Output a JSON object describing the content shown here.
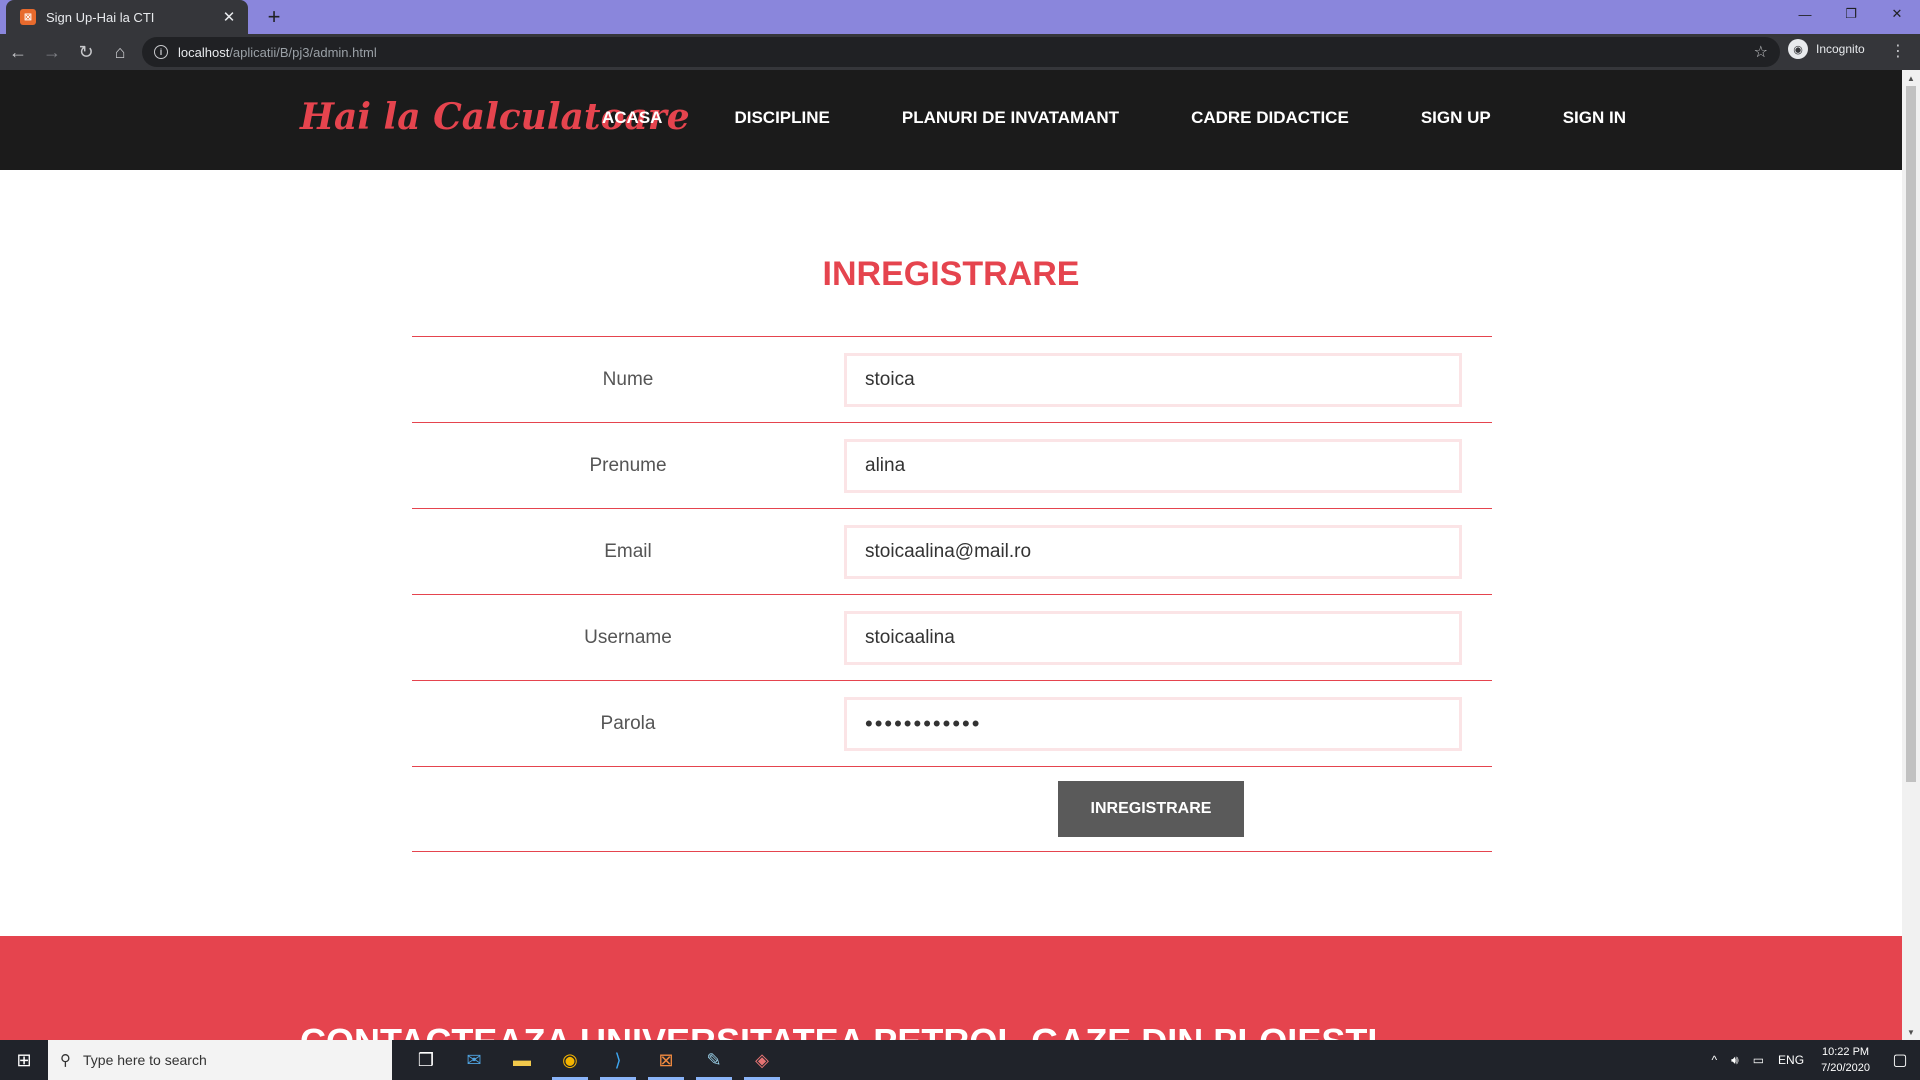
{
  "browser": {
    "tab_title": "Sign Up-Hai la CTI",
    "url_host": "localhost",
    "url_path": "/aplicatii/B/pj3/admin.html",
    "incognito_label": "Incognito"
  },
  "site": {
    "logo": "Hai la Calculatoare",
    "nav": [
      "ACASA",
      "DISCIPLINE",
      "PLANURI DE INVATAMANT",
      "CADRE DIDACTICE",
      "SIGN UP",
      "SIGN IN"
    ]
  },
  "form": {
    "title": "INREGISTRARE",
    "fields": [
      {
        "label": "Nume",
        "value": "stoica"
      },
      {
        "label": "Prenume",
        "value": "alina"
      },
      {
        "label": "Email",
        "value": "stoicaalina@mail.ro"
      },
      {
        "label": "Username",
        "value": "stoicaalina"
      },
      {
        "label": "Parola",
        "value": "••••••••••••"
      }
    ],
    "submit_label": "INREGISTRARE"
  },
  "contact": {
    "heading": "CONTACTEAZA UNIVERSITATEA PETROL-GAZE DIN PLOIESTI"
  },
  "taskbar": {
    "search_placeholder": "Type here to search",
    "language": "ENG",
    "time": "10:22 PM",
    "date": "7/20/2020"
  },
  "colors": {
    "accent": "#e5444e",
    "header_bg": "#1b1b1b",
    "button_bg": "#5a5a5a",
    "tabbar_bg": "#8a86dc"
  }
}
